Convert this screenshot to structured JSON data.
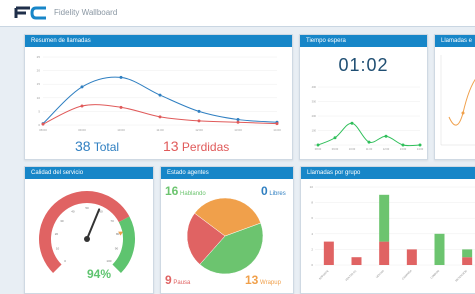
{
  "app": {
    "logo_text": "FC",
    "title": "Fidelity Wallboard"
  },
  "panels": {
    "resumen": {
      "title": "Resumen de llamadas",
      "total_value": "38",
      "total_label": "Total",
      "lost_value": "13",
      "lost_label": "Perdidas",
      "colors": {
        "total": "#2f7fc1",
        "lost": "#e05a5a"
      }
    },
    "tiempo": {
      "title": "Tiempo espera",
      "value": "01:02",
      "color": "#2fbf5a"
    },
    "llamadas_e": {
      "title": "Llamadas e"
    },
    "calidad": {
      "title": "Calidad del servicio",
      "value": "94%",
      "colors": {
        "bad": "#e06363",
        "good": "#5ec46f",
        "needle": "#333333"
      },
      "level": 0.94
    },
    "estado": {
      "title": "Estado agentes",
      "hablando_value": "16",
      "hablando_label": "Hablando",
      "libres_value": "0",
      "libres_label": "Libres",
      "pausa_value": "9",
      "pausa_label": "Pausa",
      "wrapup_value": "13",
      "wrapup_label": "Wrapup",
      "colors": {
        "hablando": "#6cc46f",
        "libres": "#2f7fc1",
        "pausa": "#e06363",
        "wrapup": "#f0a04b"
      }
    },
    "grupo": {
      "title": "Llamadas por grupo",
      "colors": {
        "red": "#e06363",
        "green": "#6cc46f"
      }
    }
  },
  "chart_data": [
    {
      "type": "line",
      "panel": "resumen",
      "x": [
        "08:00",
        "09:00",
        "10:00",
        "11:00",
        "12:00",
        "13:00",
        "14:00"
      ],
      "series": [
        {
          "values": [
            0.5,
            14,
            17.5,
            11,
            5,
            2,
            1
          ]
        },
        {
          "values": [
            0.3,
            7,
            6.5,
            3,
            1.5,
            1,
            0.5
          ]
        }
      ],
      "y_ticks": [
        "0",
        "5",
        "10",
        "15",
        "20",
        "25"
      ],
      "ylim": [
        0,
        25
      ]
    },
    {
      "type": "line",
      "panel": "tiempo",
      "x": [
        "08:00",
        "09:00",
        "10:00",
        "11:00",
        "12:00",
        "13:00",
        "14:00"
      ],
      "values": [
        0,
        50,
        150,
        20,
        60,
        0,
        0
      ],
      "y_ticks": [
        "0",
        "100",
        "200",
        "300",
        "400"
      ],
      "ylim": [
        0,
        400
      ]
    },
    {
      "type": "bar",
      "panel": "grupo",
      "categories": [
        "SOPORTE",
        "VENTAS N1",
        "VENTAS",
        "CAMPAÑA",
        "COBROS",
        "RETENCION"
      ],
      "series": [
        {
          "values": [
            3,
            1,
            3,
            2,
            0,
            1
          ]
        },
        {
          "values": [
            0,
            0,
            6,
            0,
            4,
            1
          ]
        }
      ],
      "y_ticks": [
        "0",
        "2",
        "4",
        "6",
        "8",
        "10"
      ],
      "ylim": [
        0,
        10
      ]
    }
  ]
}
